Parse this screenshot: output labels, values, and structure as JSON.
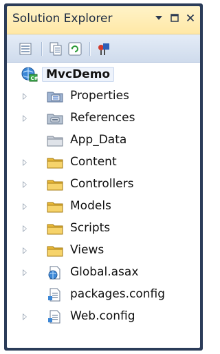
{
  "panel": {
    "title": "Solution Explorer",
    "controls": [
      "dropdown-icon",
      "maximize-icon",
      "close-icon"
    ]
  },
  "toolbar": {
    "buttons": [
      {
        "name": "properties-button",
        "icon": "properties-icon"
      },
      {
        "name": "show-all-files-button",
        "icon": "show-all-files-icon"
      },
      {
        "name": "refresh-button",
        "icon": "refresh-icon"
      },
      {
        "name": "view-class-diagram-button",
        "icon": "class-diagram-icon"
      }
    ]
  },
  "tree": {
    "root": {
      "label": "MvcDemo",
      "icon": "web-project-icon"
    },
    "items": [
      {
        "label": "Properties",
        "icon": "properties-folder-icon",
        "expandable": true
      },
      {
        "label": "References",
        "icon": "references-icon",
        "expandable": true
      },
      {
        "label": "App_Data",
        "icon": "app-data-folder-icon",
        "expandable": false
      },
      {
        "label": "Content",
        "icon": "folder-icon",
        "expandable": true
      },
      {
        "label": "Controllers",
        "icon": "folder-icon",
        "expandable": true
      },
      {
        "label": "Models",
        "icon": "folder-icon",
        "expandable": true
      },
      {
        "label": "Scripts",
        "icon": "folder-icon",
        "expandable": true
      },
      {
        "label": "Views",
        "icon": "folder-icon",
        "expandable": true
      },
      {
        "label": "Global.asax",
        "icon": "global-asax-icon",
        "expandable": true
      },
      {
        "label": "packages.config",
        "icon": "config-file-icon",
        "expandable": false
      },
      {
        "label": "Web.config",
        "icon": "config-file-icon",
        "expandable": true
      }
    ]
  },
  "colors": {
    "frame": "#2b3c59",
    "title_bg": "#fff3c8",
    "toolbar_bg": "#dbe5f2",
    "folder": "#f2c94c"
  }
}
